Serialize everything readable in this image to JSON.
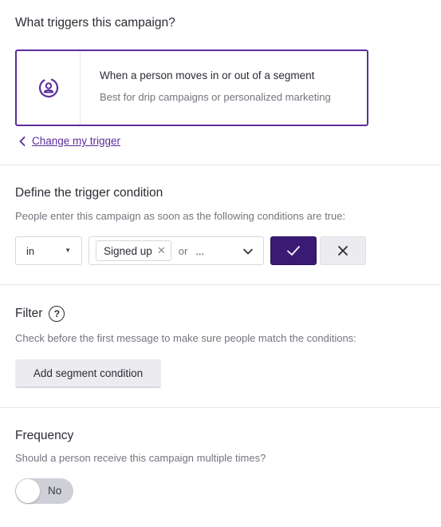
{
  "trigger": {
    "heading": "What triggers this campaign?",
    "card_title": "When a person moves in or out of a segment",
    "card_desc": "Best for drip campaigns or personalized marketing",
    "card_icon": "segment-person-icon",
    "change_link": "Change my trigger"
  },
  "condition": {
    "heading": "Define the trigger condition",
    "description": "People enter this campaign as soon as the following conditions are true:",
    "in_select": "in",
    "chips": [
      "Signed up"
    ],
    "or_text": "or",
    "ellipsis": "...",
    "confirm_icon": "check-icon",
    "cancel_icon": "close-icon"
  },
  "filter": {
    "heading": "Filter",
    "help_icon": "?",
    "description": "Check before the first message to make sure people match the conditions:",
    "add_button": "Add segment condition"
  },
  "frequency": {
    "heading": "Frequency",
    "description": "Should a person receive this campaign multiple times?",
    "toggle_label": "No",
    "toggle_on": false
  },
  "colors": {
    "accent": "#5b2d9c",
    "confirm_bg": "#3b1a73"
  }
}
